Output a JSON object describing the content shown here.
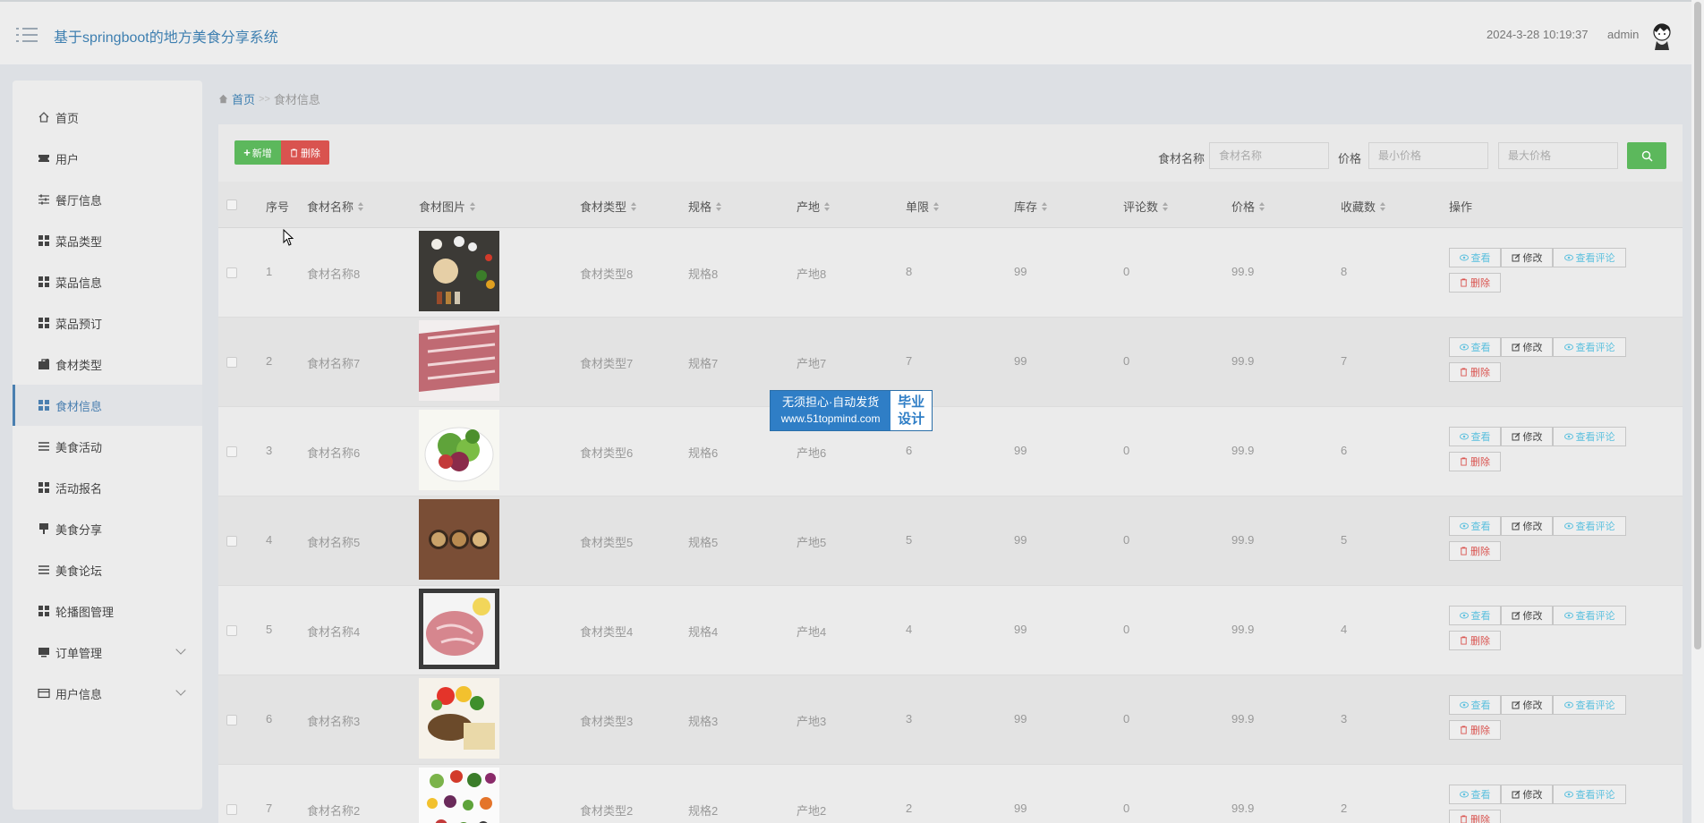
{
  "header": {
    "title": "基于springboot的地方美食分享系统",
    "datetime": "2024-3-28 10:19:37",
    "username": "admin"
  },
  "sidebar": {
    "items": [
      {
        "label": "首页",
        "icon": "home-icon"
      },
      {
        "label": "用户",
        "icon": "ticket-icon"
      },
      {
        "label": "餐厅信息",
        "icon": "sliders-icon"
      },
      {
        "label": "菜品类型",
        "icon": "grid-icon"
      },
      {
        "label": "菜品信息",
        "icon": "grid-icon"
      },
      {
        "label": "菜品预订",
        "icon": "grid-icon"
      },
      {
        "label": "食材类型",
        "icon": "briefcase-icon"
      },
      {
        "label": "食材信息",
        "icon": "grid-icon",
        "active": true
      },
      {
        "label": "美食活动",
        "icon": "list-icon"
      },
      {
        "label": "活动报名",
        "icon": "grid-icon"
      },
      {
        "label": "美食分享",
        "icon": "flag-icon"
      },
      {
        "label": "美食论坛",
        "icon": "list-icon"
      },
      {
        "label": "轮播图管理",
        "icon": "grid-icon"
      },
      {
        "label": "订单管理",
        "icon": "monitor-icon",
        "expandable": true
      },
      {
        "label": "用户信息",
        "icon": "card-icon",
        "expandable": true
      }
    ]
  },
  "breadcrumb": {
    "home": "首页",
    "separator": ">>",
    "current": "食材信息"
  },
  "toolbar": {
    "add_label": "新增",
    "delete_label": "删除",
    "name_label": "食材名称",
    "name_placeholder": "食材名称",
    "price_label": "价格",
    "min_price_placeholder": "最小价格",
    "max_price_placeholder": "最大价格"
  },
  "table": {
    "columns": [
      "序号",
      "食材名称",
      "食材图片",
      "食材类型",
      "规格",
      "产地",
      "单限",
      "库存",
      "评论数",
      "价格",
      "收藏数",
      "操作"
    ],
    "actions": {
      "view": "查看",
      "edit": "修改",
      "comments": "查看评论",
      "delete": "删除"
    },
    "rows": [
      {
        "no": "1",
        "name": "食材名称8",
        "type": "食材类型8",
        "spec": "规格8",
        "origin": "产地8",
        "limit": "8",
        "stock": "99",
        "comments": "0",
        "price": "99.9",
        "favorites": "8"
      },
      {
        "no": "2",
        "name": "食材名称7",
        "type": "食材类型7",
        "spec": "规格7",
        "origin": "产地7",
        "limit": "7",
        "stock": "99",
        "comments": "0",
        "price": "99.9",
        "favorites": "7"
      },
      {
        "no": "3",
        "name": "食材名称6",
        "type": "食材类型6",
        "spec": "规格6",
        "origin": "产地6",
        "limit": "6",
        "stock": "99",
        "comments": "0",
        "price": "99.9",
        "favorites": "6"
      },
      {
        "no": "4",
        "name": "食材名称5",
        "type": "食材类型5",
        "spec": "规格5",
        "origin": "产地5",
        "limit": "5",
        "stock": "99",
        "comments": "0",
        "price": "99.9",
        "favorites": "5"
      },
      {
        "no": "5",
        "name": "食材名称4",
        "type": "食材类型4",
        "spec": "规格4",
        "origin": "产地4",
        "limit": "4",
        "stock": "99",
        "comments": "0",
        "price": "99.9",
        "favorites": "4"
      },
      {
        "no": "6",
        "name": "食材名称3",
        "type": "食材类型3",
        "spec": "规格3",
        "origin": "产地3",
        "limit": "3",
        "stock": "99",
        "comments": "0",
        "price": "99.9",
        "favorites": "3"
      },
      {
        "no": "7",
        "name": "食材名称2",
        "type": "食材类型2",
        "spec": "规格2",
        "origin": "产地2",
        "limit": "2",
        "stock": "99",
        "comments": "0",
        "price": "99.9",
        "favorites": "2"
      }
    ]
  },
  "watermark": {
    "line1": "无须担心·自动发货",
    "url": "www.51topmind.com",
    "badge1": "毕业",
    "badge2": "设计"
  },
  "colors": {
    "accent": "#3e7fb0",
    "success": "#5cb85c",
    "danger": "#d9534f",
    "info": "#5bc0de"
  }
}
